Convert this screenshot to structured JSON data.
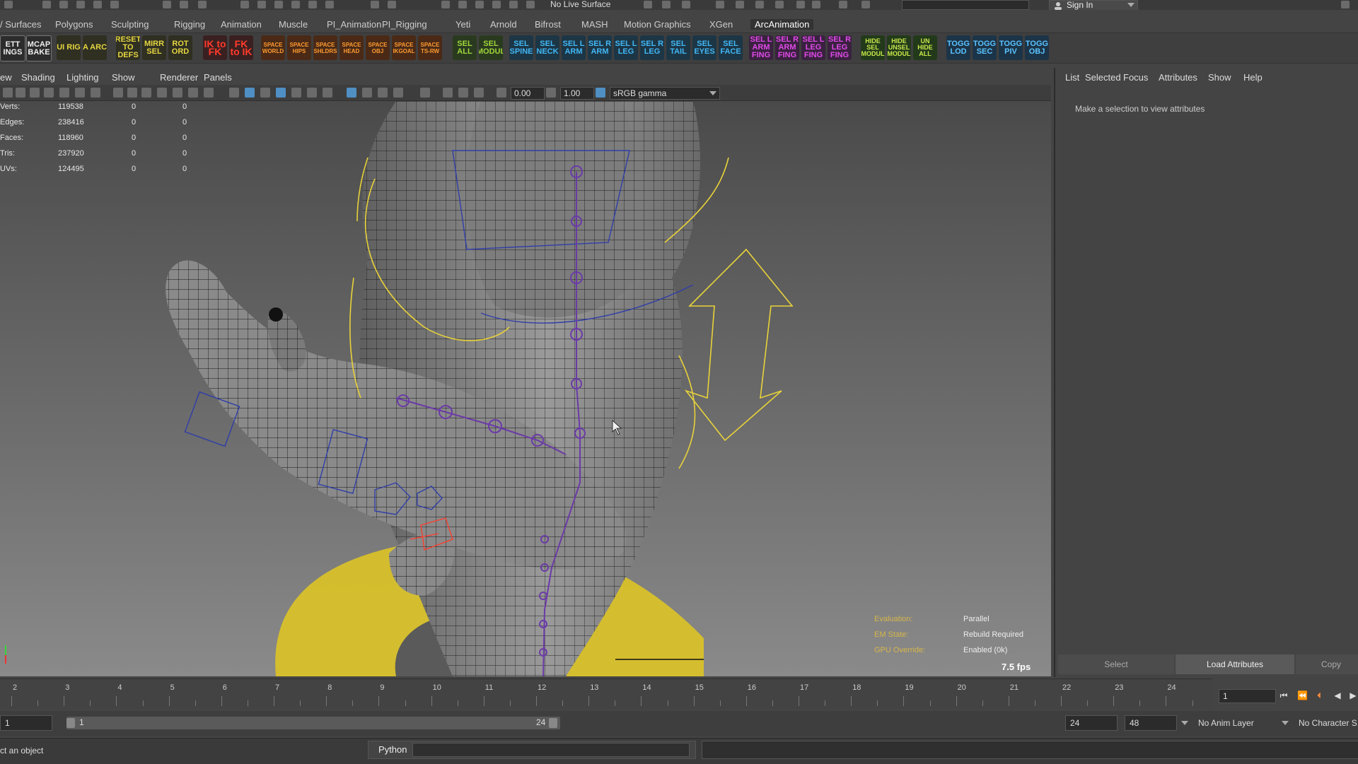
{
  "top": {
    "live_surface": "No Live Surface",
    "sign_in": "Sign In"
  },
  "menu_set": {
    "tabs": [
      "/ Surfaces",
      "Polygons",
      "Sculpting",
      "Rigging",
      "Animation",
      "Muscle",
      "PI_Animation",
      "PI_Rigging",
      "Yeti",
      "Arnold",
      "Bifrost",
      "MASH",
      "Motion Graphics",
      "XGen",
      "ArcAnimation"
    ],
    "active": "ArcAnimation"
  },
  "shelf": {
    "buttons": [
      {
        "label": "ETT INGS",
        "style": "w"
      },
      {
        "label": "MCAP BAKE",
        "style": "w"
      },
      {
        "label": "UI RIG",
        "style": "y"
      },
      {
        "label": "A ARC",
        "style": "y"
      },
      {
        "label": "RESET TO DEFS",
        "style": "y"
      },
      {
        "label": "MIRR SEL",
        "style": "y"
      },
      {
        "label": "ROT ORD",
        "style": "y"
      },
      {
        "label": "IK to FK",
        "style": "r"
      },
      {
        "label": "FK to IK",
        "style": "r"
      },
      {
        "label": "SPACE WORLD",
        "style": "o"
      },
      {
        "label": "SPACE HIPS",
        "style": "o"
      },
      {
        "label": "SPACE SHLDRS",
        "style": "o"
      },
      {
        "label": "SPACE HEAD",
        "style": "o"
      },
      {
        "label": "SPACE OBJ",
        "style": "o"
      },
      {
        "label": "SPACE IKGOAL",
        "style": "o"
      },
      {
        "label": "SPACE TS-RW",
        "style": "o"
      },
      {
        "label": "SEL ALL",
        "style": "g"
      },
      {
        "label": "SEL MODUL",
        "style": "g"
      },
      {
        "label": "SEL SPINE",
        "style": "b"
      },
      {
        "label": "SEL NECK",
        "style": "b"
      },
      {
        "label": "SEL L ARM",
        "style": "b"
      },
      {
        "label": "SEL R ARM",
        "style": "b"
      },
      {
        "label": "SEL L LEG",
        "style": "b"
      },
      {
        "label": "SEL R LEG",
        "style": "b"
      },
      {
        "label": "SEL TAIL",
        "style": "b"
      },
      {
        "label": "SEL EYES",
        "style": "b"
      },
      {
        "label": "SEL FACE",
        "style": "b"
      },
      {
        "label": "SEL L ARM FING",
        "style": "p"
      },
      {
        "label": "SEL R ARM FING",
        "style": "p"
      },
      {
        "label": "SEL L LEG FING",
        "style": "p"
      },
      {
        "label": "SEL R LEG FING",
        "style": "p"
      },
      {
        "label": "HIDE SEL MODUL",
        "style": "lg"
      },
      {
        "label": "HIDE UNSEL MODUL",
        "style": "lg"
      },
      {
        "label": "UN HIDE ALL",
        "style": "lg"
      },
      {
        "label": "TOGG LOD",
        "style": "tb"
      },
      {
        "label": "TOGG SEC",
        "style": "tb"
      },
      {
        "label": "TOGG PIV",
        "style": "tb"
      },
      {
        "label": "TOGG OBJ",
        "style": "tb"
      }
    ]
  },
  "viewport_menu": [
    "ew",
    "Shading",
    "Lighting",
    "Show",
    "Renderer",
    "Panels"
  ],
  "viewport_toolbar": {
    "exposure": "0.00",
    "gamma": "1.00",
    "color_space": "sRGB gamma"
  },
  "stats": [
    {
      "label": "Verts:",
      "v1": "119538",
      "v2": "0",
      "v3": "0"
    },
    {
      "label": "Edges:",
      "v1": "238416",
      "v2": "0",
      "v3": "0"
    },
    {
      "label": "Faces:",
      "v1": "118960",
      "v2": "0",
      "v3": "0"
    },
    {
      "label": "Tris:",
      "v1": "237920",
      "v2": "0",
      "v3": "0"
    },
    {
      "label": "UVs:",
      "v1": "124495",
      "v2": "0",
      "v3": "0"
    }
  ],
  "hud": {
    "evaluation_label": "Evaluation:",
    "evaluation": "Parallel",
    "em_label": "EM State:",
    "em": "Rebuild Required",
    "gpu_label": "GPU Override:",
    "gpu": "Enabled (0k)",
    "fps": "7.5 fps"
  },
  "attr_editor": {
    "menu": [
      "List",
      "Selected",
      "Focus",
      "Attributes",
      "Show",
      "Help"
    ],
    "message": "Make a selection to view attributes",
    "select_btn": "Select",
    "load_btn": "Load Attributes",
    "copy_btn": "Copy"
  },
  "timeline": {
    "ticks": [
      "2",
      "3",
      "4",
      "5",
      "6",
      "7",
      "8",
      "9",
      "10",
      "11",
      "12",
      "13",
      "14",
      "15",
      "16",
      "17",
      "18",
      "19",
      "20",
      "21",
      "22",
      "23",
      "24"
    ],
    "current_frame": "1"
  },
  "range": {
    "start": "1",
    "range_start": "1",
    "range_end": "24",
    "end": "24",
    "anim_end": "48",
    "anim_layer": "No Anim Layer",
    "character": "No Character S"
  },
  "cmd": {
    "help": "ct an object",
    "lang": "Python"
  },
  "colors": {
    "ring": "#d8c12a",
    "wire": "#111111",
    "controls_yellow": "#e8d23a",
    "joints": "#6b3aa8"
  }
}
